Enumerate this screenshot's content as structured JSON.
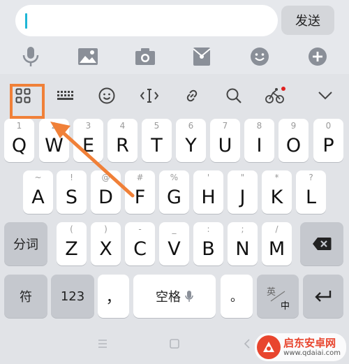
{
  "chat": {
    "input_value": "",
    "send_label": "发送",
    "icons": [
      "microphone-icon",
      "image-icon",
      "camera-icon",
      "red-packet-icon",
      "emoji-icon",
      "plus-icon"
    ]
  },
  "toolbar": {
    "icons": [
      "grid-menu-icon",
      "keyboard-icon",
      "emoji-icon",
      "cursor-icon",
      "link-icon",
      "search-icon",
      "cycling-icon",
      "chevron-down-icon"
    ]
  },
  "rows": {
    "row1": [
      {
        "main": "Q",
        "sub": "1"
      },
      {
        "main": "W",
        "sub": "2"
      },
      {
        "main": "E",
        "sub": "3"
      },
      {
        "main": "R",
        "sub": "4"
      },
      {
        "main": "T",
        "sub": "5"
      },
      {
        "main": "Y",
        "sub": "6"
      },
      {
        "main": "U",
        "sub": "7"
      },
      {
        "main": "I",
        "sub": "8"
      },
      {
        "main": "O",
        "sub": "9"
      },
      {
        "main": "P",
        "sub": "0"
      }
    ],
    "row2": [
      {
        "main": "A",
        "sub": "~"
      },
      {
        "main": "S",
        "sub": "!"
      },
      {
        "main": "D",
        "sub": "@"
      },
      {
        "main": "F",
        "sub": "#"
      },
      {
        "main": "G",
        "sub": "%"
      },
      {
        "main": "H",
        "sub": "'"
      },
      {
        "main": "J",
        "sub": "\""
      },
      {
        "main": "K",
        "sub": "*"
      },
      {
        "main": "L",
        "sub": "?"
      }
    ],
    "row3": [
      {
        "main": "Z",
        "sub": "("
      },
      {
        "main": "X",
        "sub": ")"
      },
      {
        "main": "C",
        "sub": "-"
      },
      {
        "main": "V",
        "sub": "_"
      },
      {
        "main": "B",
        "sub": ":"
      },
      {
        "main": "N",
        "sub": ";"
      },
      {
        "main": "M",
        "sub": "/"
      }
    ]
  },
  "keys": {
    "fenci": "分词",
    "fu": "符",
    "num": "123",
    "comma": "，",
    "space": "空格",
    "period": "。",
    "lang_top": "英",
    "lang_bottom": "中"
  },
  "watermark": {
    "title": "启东安卓网",
    "url": "www.qdaiai.com"
  },
  "colors": {
    "accent_orange": "#f08038",
    "caret_cyan": "#1eb6d6",
    "notify_red": "#e02020"
  }
}
